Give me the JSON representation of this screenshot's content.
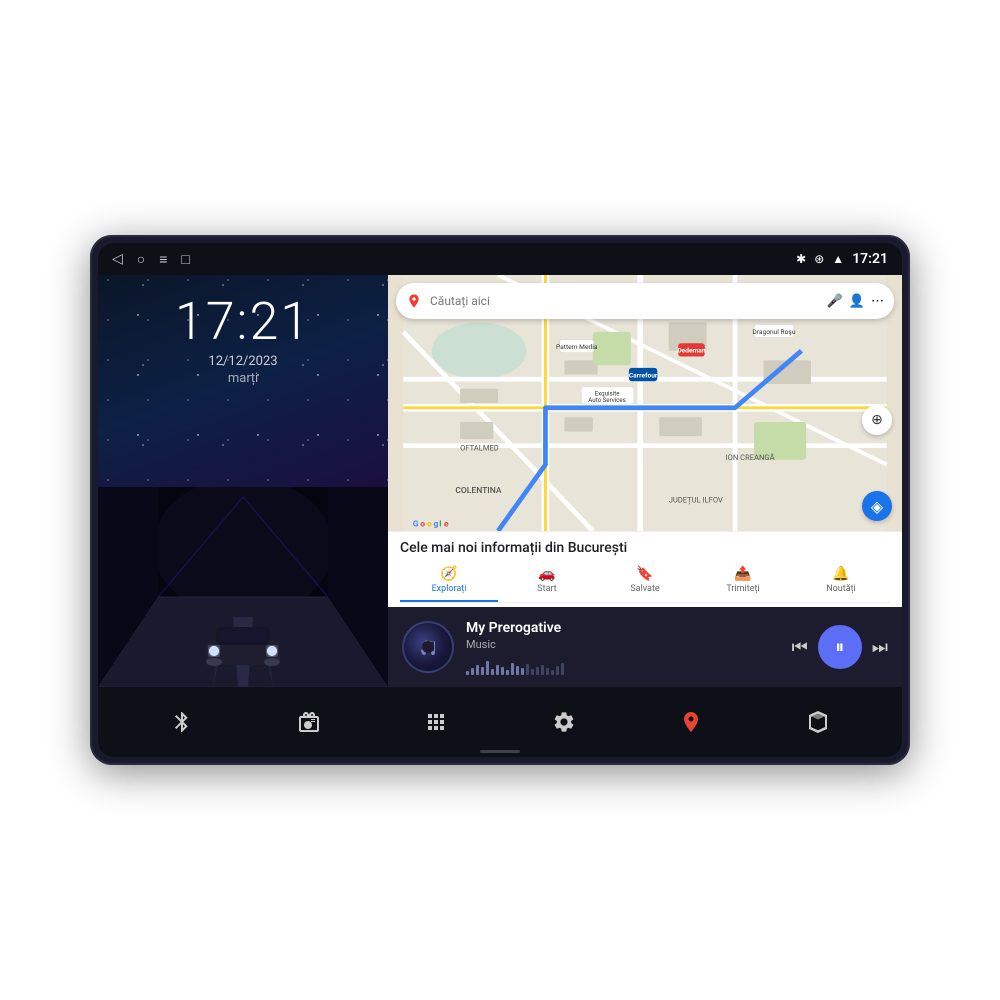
{
  "device": {
    "status_bar": {
      "time": "17:21",
      "bluetooth_icon": "bluetooth",
      "wifi_icon": "wifi",
      "signal_icon": "signal"
    },
    "nav_icons": {
      "back": "◁",
      "home": "○",
      "menu": "≡",
      "screenshot": "□"
    }
  },
  "left_panel": {
    "clock": "17:21",
    "date": "12/12/2023",
    "day": "marți"
  },
  "right_panel": {
    "map": {
      "search_placeholder": "Căutați aici",
      "info_title": "Cele mai noi informații din București",
      "nav_tabs": [
        {
          "label": "Explorați",
          "icon": "🧭",
          "active": true
        },
        {
          "label": "Start",
          "icon": "🚗",
          "active": false
        },
        {
          "label": "Salvate",
          "icon": "🔖",
          "active": false
        },
        {
          "label": "Trimiteți",
          "icon": "📤",
          "active": false
        },
        {
          "label": "Noutăți",
          "icon": "🔔",
          "active": false
        }
      ]
    },
    "music": {
      "song_title": "My Prerogative",
      "song_subtitle": "Music",
      "controls": {
        "prev": "⏮",
        "play": "⏸",
        "next": "⏭"
      }
    }
  },
  "bottom_dock": {
    "items": [
      {
        "icon": "bluetooth",
        "label": "Bluetooth"
      },
      {
        "icon": "radio",
        "label": "Radio"
      },
      {
        "icon": "grid",
        "label": "Apps"
      },
      {
        "icon": "settings",
        "label": "Settings"
      },
      {
        "icon": "maps",
        "label": "Maps"
      },
      {
        "icon": "box",
        "label": "3D"
      }
    ]
  },
  "waveform_heights": [
    4,
    7,
    10,
    8,
    14,
    6,
    10,
    8,
    5,
    12,
    9,
    7,
    11,
    6,
    8,
    10,
    7,
    5,
    9,
    12
  ]
}
